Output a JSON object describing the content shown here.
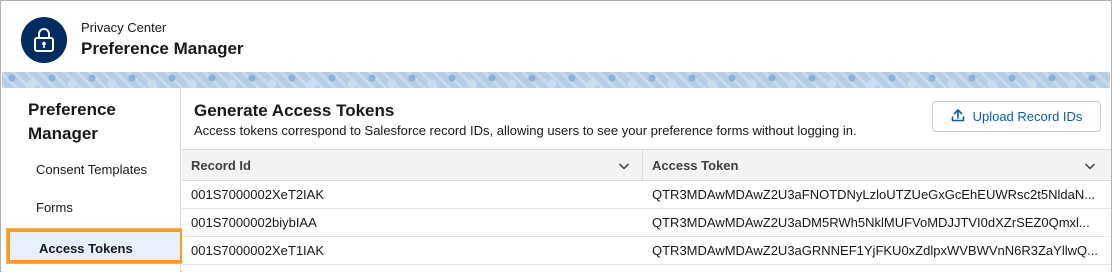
{
  "header": {
    "super_title": "Privacy Center",
    "title": "Preference Manager",
    "icon": "lock-icon"
  },
  "sidebar": {
    "heading": "Preference Manager",
    "items": [
      {
        "label": "Consent Templates",
        "active": false
      },
      {
        "label": "Forms",
        "active": false
      },
      {
        "label": "Access Tokens",
        "active": true
      }
    ]
  },
  "main": {
    "title": "Generate Access Tokens",
    "description": "Access tokens correspond to Salesforce record IDs, allowing users to see your preference forms without logging in.",
    "upload_button": {
      "label": "Upload Record IDs",
      "icon": "upload-icon"
    },
    "table": {
      "columns": [
        "Record Id",
        "Access Token"
      ],
      "rows": [
        [
          "001S7000002XeT2IAK",
          "QTR3MDAwMDAwZ2U3aFNOTDNyLzloUTZUeGxGcEhEUWRsc2t5NldaN..."
        ],
        [
          "001S7000002biybIAA",
          "QTR3MDAwMDAwZ2U3aDM5RWh5NklMUFVoMDJJTVI0dXZrSEZ0Qmxl..."
        ],
        [
          "001S7000002XeT1IAK",
          "QTR3MDAwMDAwZ2U3aGRNNEF1YjFKU0xZdlpxWVBWVnN6R3ZaYllwQ..."
        ]
      ]
    }
  },
  "colors": {
    "brand_navy": "#032d60",
    "link_blue": "#0b5cab",
    "highlight_orange": "#f59a23",
    "active_bg": "#e5f0fc"
  }
}
